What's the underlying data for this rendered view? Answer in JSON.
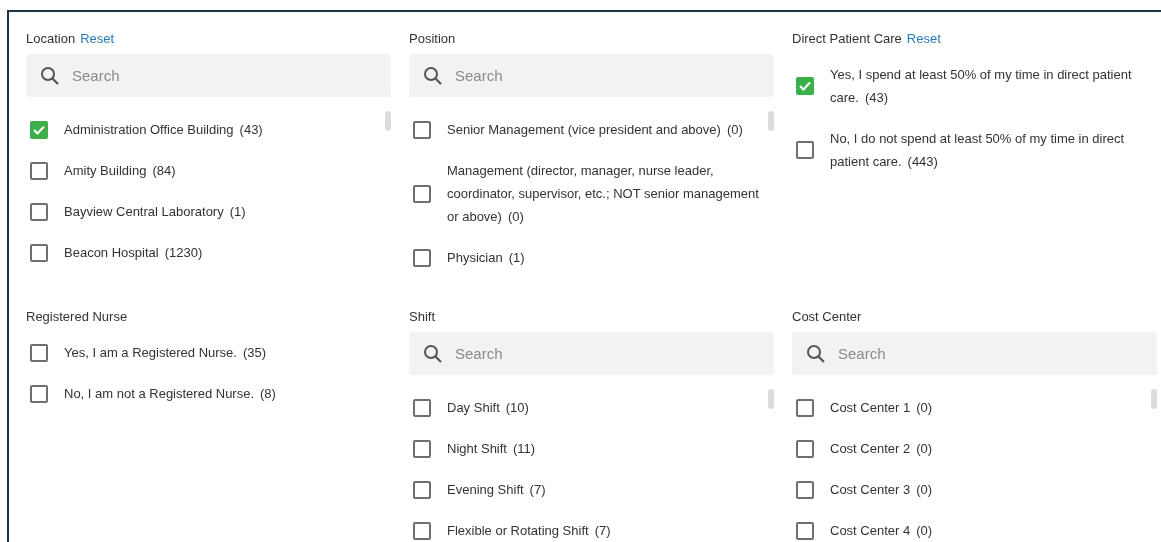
{
  "filters": [
    {
      "title": "Location",
      "reset": "Reset",
      "search": {
        "placeholder": "Search"
      },
      "options": [
        {
          "label": "Administration Office Building",
          "count": "(43)",
          "checked": true
        },
        {
          "label": "Amity Building",
          "count": "(84)",
          "checked": false
        },
        {
          "label": "Bayview Central Laboratory",
          "count": "(1)",
          "checked": false
        },
        {
          "label": "Beacon Hospital",
          "count": "(1230)",
          "checked": false
        }
      ]
    },
    {
      "title": "Position",
      "search": {
        "placeholder": "Search"
      },
      "options": [
        {
          "label": "Senior Management (vice president and above)",
          "count": "(0)",
          "checked": false
        },
        {
          "label": "Management (director, manager, nurse leader, coordinator, supervisor, etc.; NOT senior management or above)",
          "count": "(0)",
          "checked": false
        },
        {
          "label": "Physician",
          "count": "(1)",
          "checked": false
        }
      ]
    },
    {
      "title": "Direct Patient Care",
      "reset": "Reset",
      "options": [
        {
          "label": "Yes, I spend at least 50% of my time in direct patient care.",
          "count": "(43)",
          "checked": true
        },
        {
          "label": "No, I do not spend at least 50% of my time in direct patient care.",
          "count": "(443)",
          "checked": false
        }
      ]
    },
    {
      "title": "Registered Nurse",
      "options": [
        {
          "label": "Yes, I am a Registered Nurse.",
          "count": "(35)",
          "checked": false
        },
        {
          "label": "No, I am not a Registered Nurse.",
          "count": "(8)",
          "checked": false
        }
      ]
    },
    {
      "title": "Shift",
      "search": {
        "placeholder": "Search"
      },
      "options": [
        {
          "label": "Day Shift",
          "count": "(10)",
          "checked": false
        },
        {
          "label": "Night Shift",
          "count": "(11)",
          "checked": false
        },
        {
          "label": "Evening Shift",
          "count": "(7)",
          "checked": false
        },
        {
          "label": "Flexible or Rotating Shift",
          "count": "(7)",
          "checked": false
        }
      ]
    },
    {
      "title": "Cost Center",
      "search": {
        "placeholder": "Search"
      },
      "options": [
        {
          "label": "Cost Center 1",
          "count": "(0)",
          "checked": false
        },
        {
          "label": "Cost Center 2",
          "count": "(0)",
          "checked": false
        },
        {
          "label": "Cost Center 3",
          "count": "(0)",
          "checked": false
        },
        {
          "label": "Cost Center 4",
          "count": "(0)",
          "checked": false
        }
      ]
    }
  ]
}
